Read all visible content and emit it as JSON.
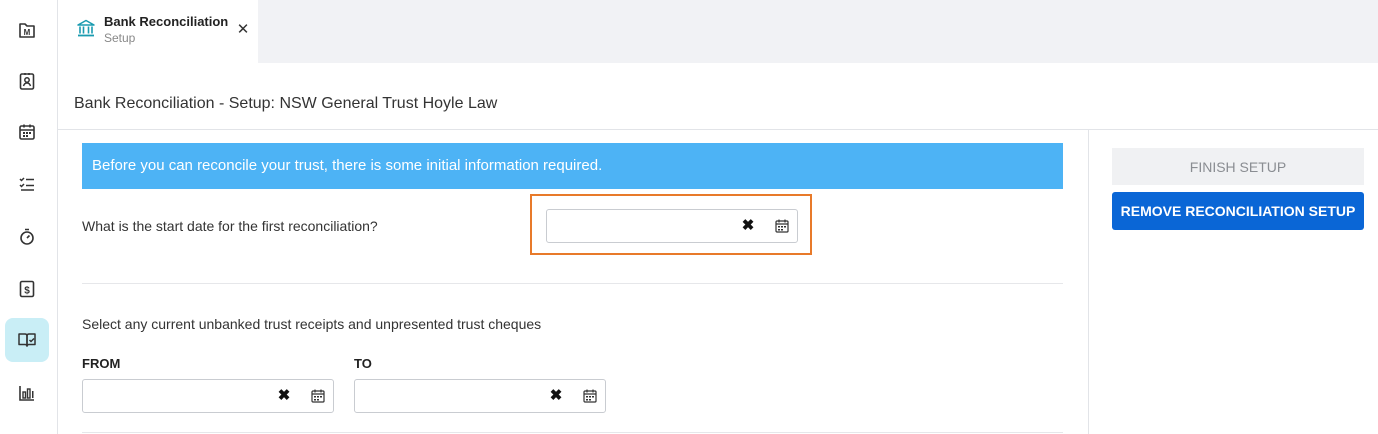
{
  "sidebar": {
    "items": [
      {
        "icon": "matter-icon",
        "label": "M"
      },
      {
        "icon": "contact-card-icon"
      },
      {
        "icon": "calendar-icon"
      },
      {
        "icon": "tasks-icon"
      },
      {
        "icon": "stopwatch-icon"
      },
      {
        "icon": "billing-icon",
        "label": "$"
      },
      {
        "icon": "reconciliation-icon",
        "active": true
      },
      {
        "icon": "reports-icon"
      }
    ],
    "active_color": "#c9eef6"
  },
  "tab": {
    "title": "Bank Reconciliation",
    "subtitle": "Setup",
    "close_label": "✕",
    "icon": "bank-icon",
    "icon_color": "#1a9bb0"
  },
  "page": {
    "title": "Bank Reconciliation - Setup: NSW General Trust Hoyle Law"
  },
  "banner": {
    "text": "Before you can reconcile your trust, there is some initial information required.",
    "color": "#4db3f5"
  },
  "start_date": {
    "question": "What is the start date for the first reconciliation?",
    "value": "",
    "clear_label": "✖",
    "highlight_color": "#e87a2a"
  },
  "range": {
    "instruction": "Select any current unbanked trust receipts and unpresented trust cheques",
    "from_label": "FROM",
    "to_label": "TO",
    "from_value": "",
    "to_value": "",
    "clear_label": "✖"
  },
  "actions": {
    "finish_label": "FINISH SETUP",
    "remove_label": "REMOVE RECONCILIATION SETUP",
    "remove_color": "#0a66d6"
  }
}
